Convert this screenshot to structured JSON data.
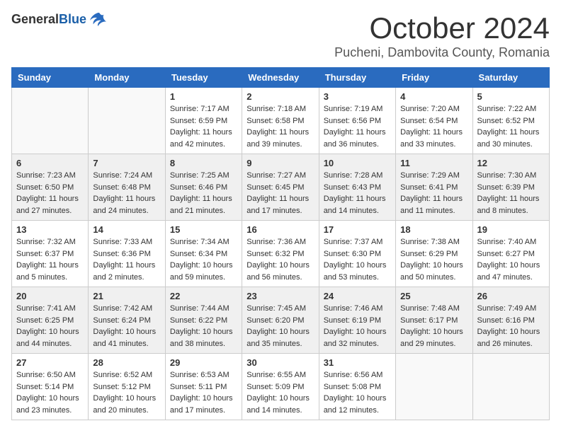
{
  "header": {
    "logo_general": "General",
    "logo_blue": "Blue",
    "month": "October 2024",
    "location": "Pucheni, Dambovita County, Romania"
  },
  "days_of_week": [
    "Sunday",
    "Monday",
    "Tuesday",
    "Wednesday",
    "Thursday",
    "Friday",
    "Saturday"
  ],
  "weeks": [
    [
      {
        "day": "",
        "content": ""
      },
      {
        "day": "",
        "content": ""
      },
      {
        "day": "1",
        "content": "Sunrise: 7:17 AM\nSunset: 6:59 PM\nDaylight: 11 hours and 42 minutes."
      },
      {
        "day": "2",
        "content": "Sunrise: 7:18 AM\nSunset: 6:58 PM\nDaylight: 11 hours and 39 minutes."
      },
      {
        "day": "3",
        "content": "Sunrise: 7:19 AM\nSunset: 6:56 PM\nDaylight: 11 hours and 36 minutes."
      },
      {
        "day": "4",
        "content": "Sunrise: 7:20 AM\nSunset: 6:54 PM\nDaylight: 11 hours and 33 minutes."
      },
      {
        "day": "5",
        "content": "Sunrise: 7:22 AM\nSunset: 6:52 PM\nDaylight: 11 hours and 30 minutes."
      }
    ],
    [
      {
        "day": "6",
        "content": "Sunrise: 7:23 AM\nSunset: 6:50 PM\nDaylight: 11 hours and 27 minutes."
      },
      {
        "day": "7",
        "content": "Sunrise: 7:24 AM\nSunset: 6:48 PM\nDaylight: 11 hours and 24 minutes."
      },
      {
        "day": "8",
        "content": "Sunrise: 7:25 AM\nSunset: 6:46 PM\nDaylight: 11 hours and 21 minutes."
      },
      {
        "day": "9",
        "content": "Sunrise: 7:27 AM\nSunset: 6:45 PM\nDaylight: 11 hours and 17 minutes."
      },
      {
        "day": "10",
        "content": "Sunrise: 7:28 AM\nSunset: 6:43 PM\nDaylight: 11 hours and 14 minutes."
      },
      {
        "day": "11",
        "content": "Sunrise: 7:29 AM\nSunset: 6:41 PM\nDaylight: 11 hours and 11 minutes."
      },
      {
        "day": "12",
        "content": "Sunrise: 7:30 AM\nSunset: 6:39 PM\nDaylight: 11 hours and 8 minutes."
      }
    ],
    [
      {
        "day": "13",
        "content": "Sunrise: 7:32 AM\nSunset: 6:37 PM\nDaylight: 11 hours and 5 minutes."
      },
      {
        "day": "14",
        "content": "Sunrise: 7:33 AM\nSunset: 6:36 PM\nDaylight: 11 hours and 2 minutes."
      },
      {
        "day": "15",
        "content": "Sunrise: 7:34 AM\nSunset: 6:34 PM\nDaylight: 10 hours and 59 minutes."
      },
      {
        "day": "16",
        "content": "Sunrise: 7:36 AM\nSunset: 6:32 PM\nDaylight: 10 hours and 56 minutes."
      },
      {
        "day": "17",
        "content": "Sunrise: 7:37 AM\nSunset: 6:30 PM\nDaylight: 10 hours and 53 minutes."
      },
      {
        "day": "18",
        "content": "Sunrise: 7:38 AM\nSunset: 6:29 PM\nDaylight: 10 hours and 50 minutes."
      },
      {
        "day": "19",
        "content": "Sunrise: 7:40 AM\nSunset: 6:27 PM\nDaylight: 10 hours and 47 minutes."
      }
    ],
    [
      {
        "day": "20",
        "content": "Sunrise: 7:41 AM\nSunset: 6:25 PM\nDaylight: 10 hours and 44 minutes."
      },
      {
        "day": "21",
        "content": "Sunrise: 7:42 AM\nSunset: 6:24 PM\nDaylight: 10 hours and 41 minutes."
      },
      {
        "day": "22",
        "content": "Sunrise: 7:44 AM\nSunset: 6:22 PM\nDaylight: 10 hours and 38 minutes."
      },
      {
        "day": "23",
        "content": "Sunrise: 7:45 AM\nSunset: 6:20 PM\nDaylight: 10 hours and 35 minutes."
      },
      {
        "day": "24",
        "content": "Sunrise: 7:46 AM\nSunset: 6:19 PM\nDaylight: 10 hours and 32 minutes."
      },
      {
        "day": "25",
        "content": "Sunrise: 7:48 AM\nSunset: 6:17 PM\nDaylight: 10 hours and 29 minutes."
      },
      {
        "day": "26",
        "content": "Sunrise: 7:49 AM\nSunset: 6:16 PM\nDaylight: 10 hours and 26 minutes."
      }
    ],
    [
      {
        "day": "27",
        "content": "Sunrise: 6:50 AM\nSunset: 5:14 PM\nDaylight: 10 hours and 23 minutes."
      },
      {
        "day": "28",
        "content": "Sunrise: 6:52 AM\nSunset: 5:12 PM\nDaylight: 10 hours and 20 minutes."
      },
      {
        "day": "29",
        "content": "Sunrise: 6:53 AM\nSunset: 5:11 PM\nDaylight: 10 hours and 17 minutes."
      },
      {
        "day": "30",
        "content": "Sunrise: 6:55 AM\nSunset: 5:09 PM\nDaylight: 10 hours and 14 minutes."
      },
      {
        "day": "31",
        "content": "Sunrise: 6:56 AM\nSunset: 5:08 PM\nDaylight: 10 hours and 12 minutes."
      },
      {
        "day": "",
        "content": ""
      },
      {
        "day": "",
        "content": ""
      }
    ]
  ]
}
